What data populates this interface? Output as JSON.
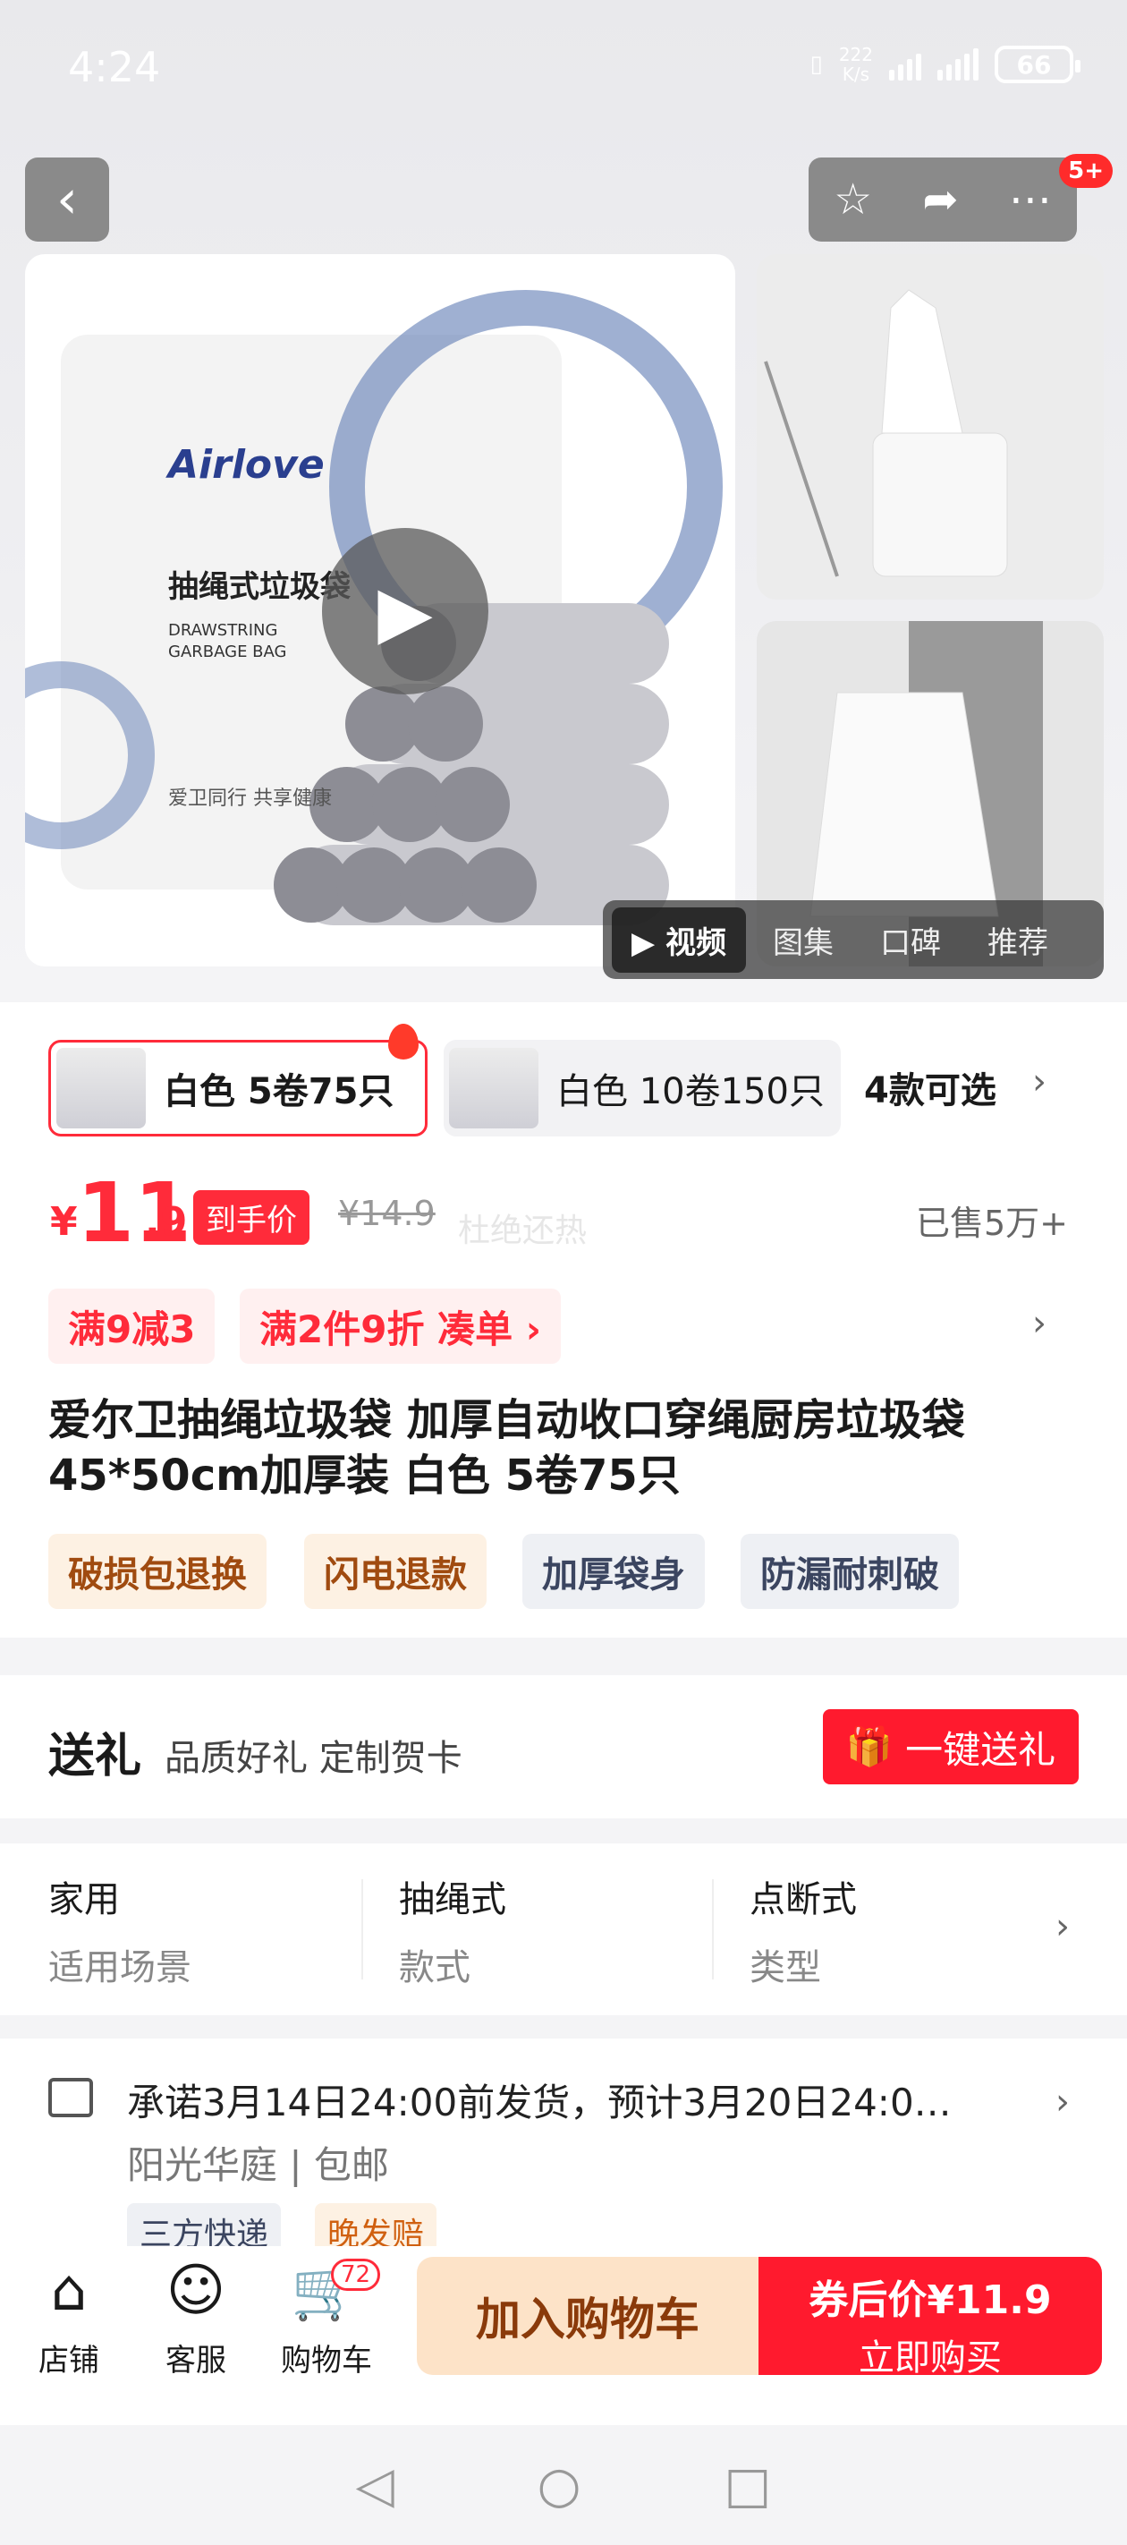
{
  "status_bar": {
    "time": "4:24",
    "net_speed": "222",
    "net_unit": "K/s",
    "battery": "66"
  },
  "header": {
    "cart_badge": "5+"
  },
  "gallery": {
    "brand": "Airlove",
    "product_label": "抽绳式垃圾袋",
    "product_label_en1": "DRAWSTRING",
    "product_label_en2": "GARBAGE BAG",
    "slogan": "爱卫同行 共享健康",
    "tabs": [
      "视频",
      "图集",
      "口碑",
      "推荐"
    ]
  },
  "variants": {
    "selected": "白色 5卷75只",
    "other": "白色 10卷150只",
    "more": "4款可选"
  },
  "price": {
    "currency": "¥",
    "integer": "11",
    "decimal": ".9",
    "tag": "到手价",
    "original": "¥14.9",
    "watermark": "杜绝还热",
    "sold": "已售5万+"
  },
  "promos": [
    "满9减3",
    "满2件9折",
    "凑单 ›"
  ],
  "title": "爱尔卫抽绳垃圾袋 加厚自动收口穿绳厨房垃圾袋45*50cm加厚装 白色 5卷75只",
  "service_tags": [
    "破损包退换",
    "闪电退款",
    "加厚袋身",
    "防漏耐刺破"
  ],
  "gift": {
    "label": "送礼",
    "sub": "品质好礼 定制贺卡",
    "button": "一键送礼"
  },
  "specs": [
    {
      "value": "家用",
      "key": "适用场景"
    },
    {
      "value": "抽绳式",
      "key": "款式"
    },
    {
      "value": "点断式",
      "key": "类型"
    }
  ],
  "shipping": {
    "promise": "承诺3月14日24:00前发货，预计3月20日24:0…",
    "address": "阳光华庭",
    "postage": "包邮",
    "tags": [
      "三方快递",
      "晚发赔"
    ]
  },
  "bottom_bar": {
    "tabs": [
      {
        "label": "店铺"
      },
      {
        "label": "客服"
      },
      {
        "label": "购物车"
      }
    ],
    "cart_count": "72",
    "add_cart": "加入购物车",
    "buy_line1": "券后价¥11.9",
    "buy_line2": "立即购买"
  }
}
